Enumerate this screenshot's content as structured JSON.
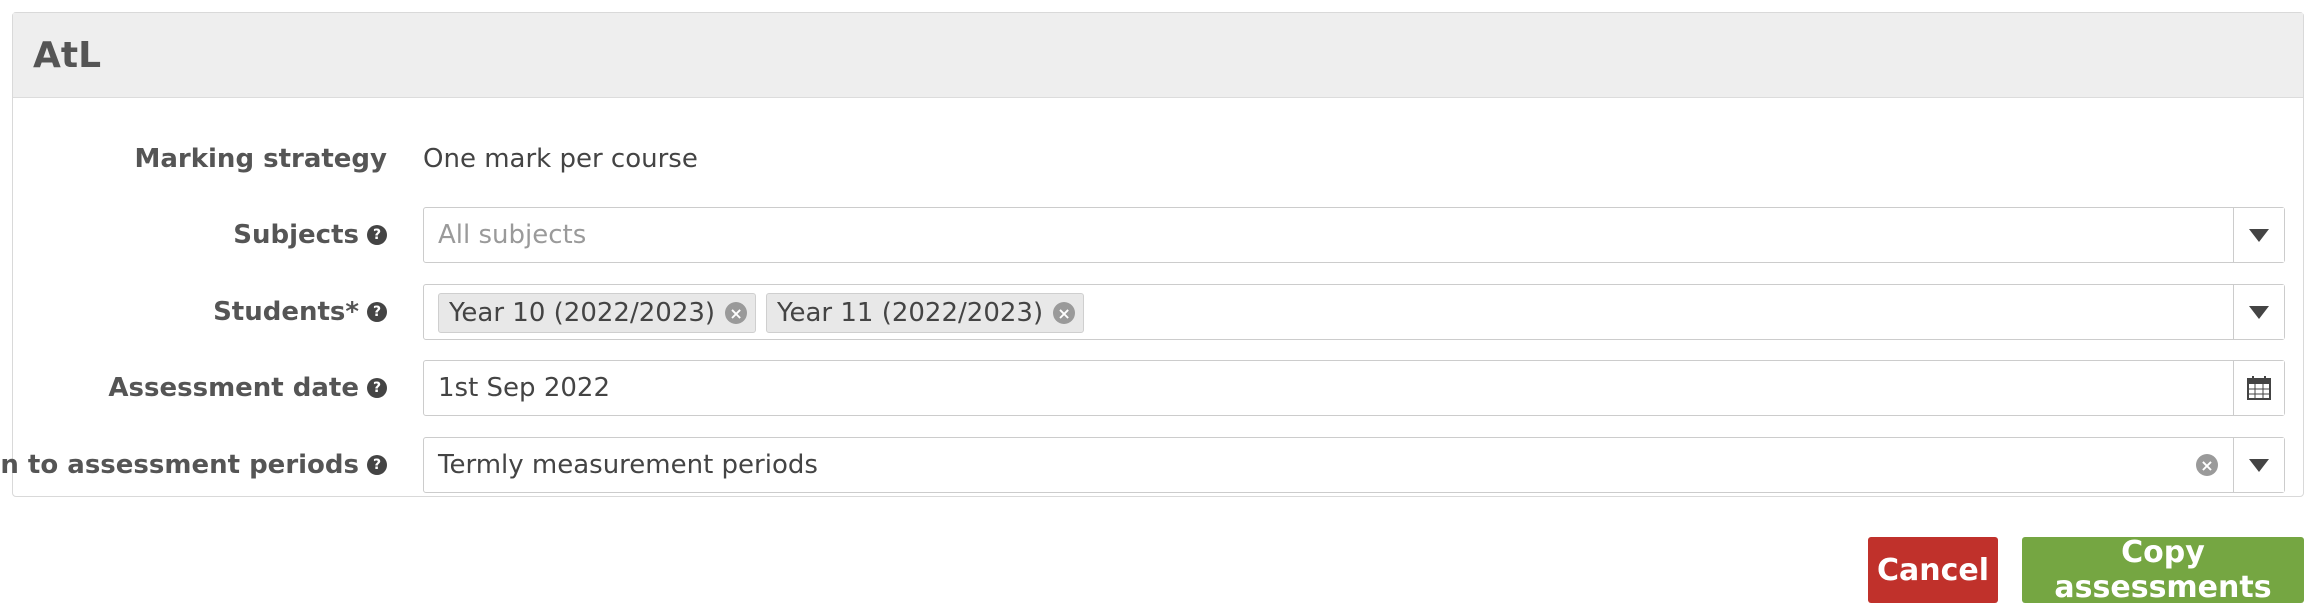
{
  "panel": {
    "title": "AtL"
  },
  "form": {
    "marking_strategy": {
      "label": "Marking strategy",
      "value": "One mark per course"
    },
    "subjects": {
      "label": "Subjects",
      "placeholder": "All subjects"
    },
    "students": {
      "label": "Students*",
      "tags": [
        "Year 10 (2022/2023)",
        "Year 11 (2022/2023)"
      ]
    },
    "assessment_date": {
      "label": "Assessment date",
      "value": "1st Sep 2022"
    },
    "assessment_periods": {
      "label": "Align to assessment periods",
      "value": "Termly measurement periods"
    }
  },
  "icons": {
    "help": "question-circle-icon",
    "dropdown": "caret-down-icon",
    "remove": "times-circle-icon",
    "calendar": "calendar-icon"
  },
  "buttons": {
    "cancel": "Cancel",
    "copy": "Copy assessments"
  },
  "colors": {
    "cancel": "#c0312b",
    "copy": "#75a642",
    "header_bg": "#eeeeee"
  }
}
